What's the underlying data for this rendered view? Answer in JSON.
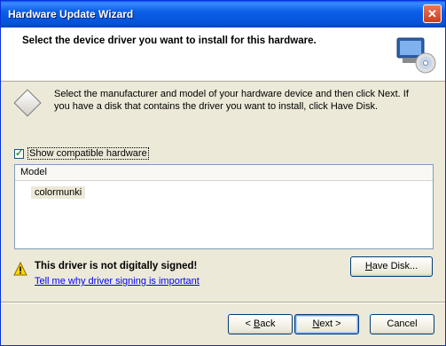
{
  "window": {
    "title": "Hardware Update Wizard",
    "close_glyph": "✕"
  },
  "header": {
    "heading": "Select the device driver you want to install for this hardware."
  },
  "body": {
    "description": "Select the manufacturer and model of your hardware device and then click Next. If you have a disk that contains the driver you want to install, click Have Disk.",
    "show_compatible": {
      "label": "Show compatible hardware",
      "checked": true
    },
    "list": {
      "column": "Model",
      "items": [
        "colormunki"
      ]
    },
    "warning": {
      "title": "This driver is not digitally signed!",
      "link": "Tell me why driver signing is important"
    },
    "have_disk": {
      "pre": "",
      "ul": "H",
      "post": "ave Disk..."
    }
  },
  "footer": {
    "back": {
      "pre": "< ",
      "ul": "B",
      "post": "ack"
    },
    "next": {
      "pre": "",
      "ul": "N",
      "post": "ext >"
    },
    "cancel": {
      "label": "Cancel"
    }
  }
}
